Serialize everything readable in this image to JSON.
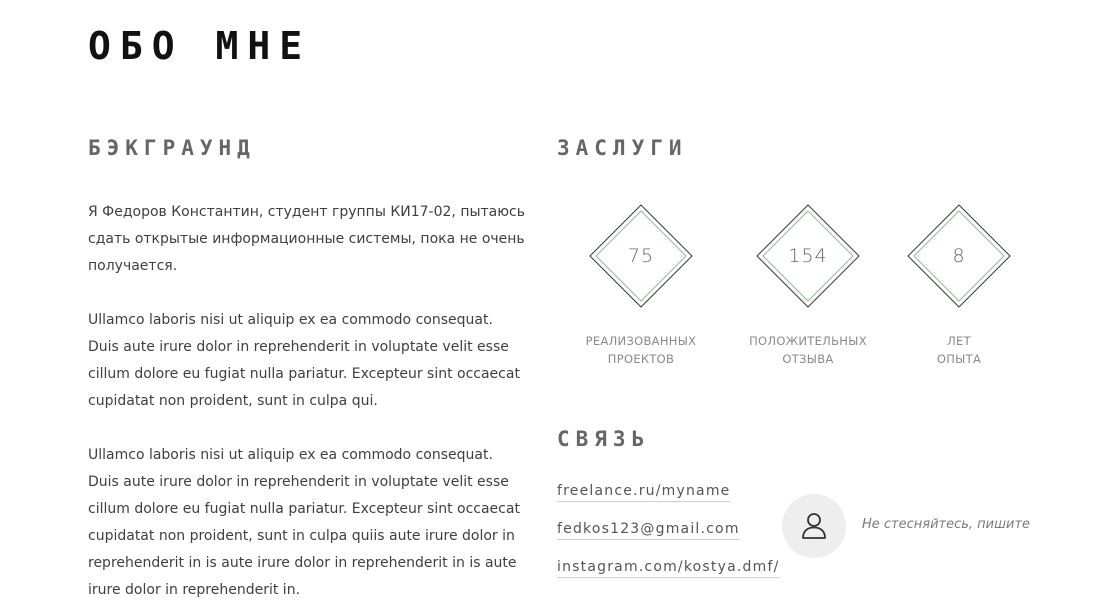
{
  "page_title": "ОБО МНЕ",
  "background": {
    "title": "БЭКГРАУНД",
    "paragraphs": [
      "Я Федоров Константин, студент группы КИ17-02, пытаюсь сдать открытые информационные системы, пока не очень получается.",
      "Ullamco laboris nisi ut aliquip ex ea commodo consequat. Duis aute irure dolor in reprehenderit in voluptate velit esse cillum dolore eu fugiat nulla pariatur. Excepteur sint occaecat cupidatat non proident, sunt in culpa qui.",
      "Ullamco laboris nisi ut aliquip ex ea commodo consequat. Duis aute irure dolor in reprehenderit in voluptate velit esse cillum dolore eu fugiat nulla pariatur. Excepteur sint occaecat cupidatat non proident, sunt in culpa quiis aute irure dolor in reprehenderit in is aute irure dolor in reprehenderit in is aute irure dolor in reprehenderit in."
    ]
  },
  "merits": {
    "title": "ЗАСЛУГИ",
    "stats": [
      {
        "value": "75",
        "label_line1": "РЕАЛИЗОВАННЫХ",
        "label_line2": "ПРОЕКТОВ"
      },
      {
        "value": "154",
        "label_line1": "ПОЛОЖИТЕЛЬНЫХ",
        "label_line2": "ОТЗЫВА"
      },
      {
        "value": "8",
        "label_line1": "ЛЕТ",
        "label_line2": "ОПЫТА"
      }
    ],
    "diamond_inner_color": "#8fc08f",
    "diamond_outer_color": "#3a3a3a"
  },
  "contact": {
    "title": "СВЯЗЬ",
    "links": [
      "freelance.ru/myname",
      "fedkos123@gmail.com",
      "instagram.com/kostya.dmf/"
    ],
    "avatar_icon": "user-icon",
    "cta_text": "Не стесняйтесь, пишите"
  }
}
